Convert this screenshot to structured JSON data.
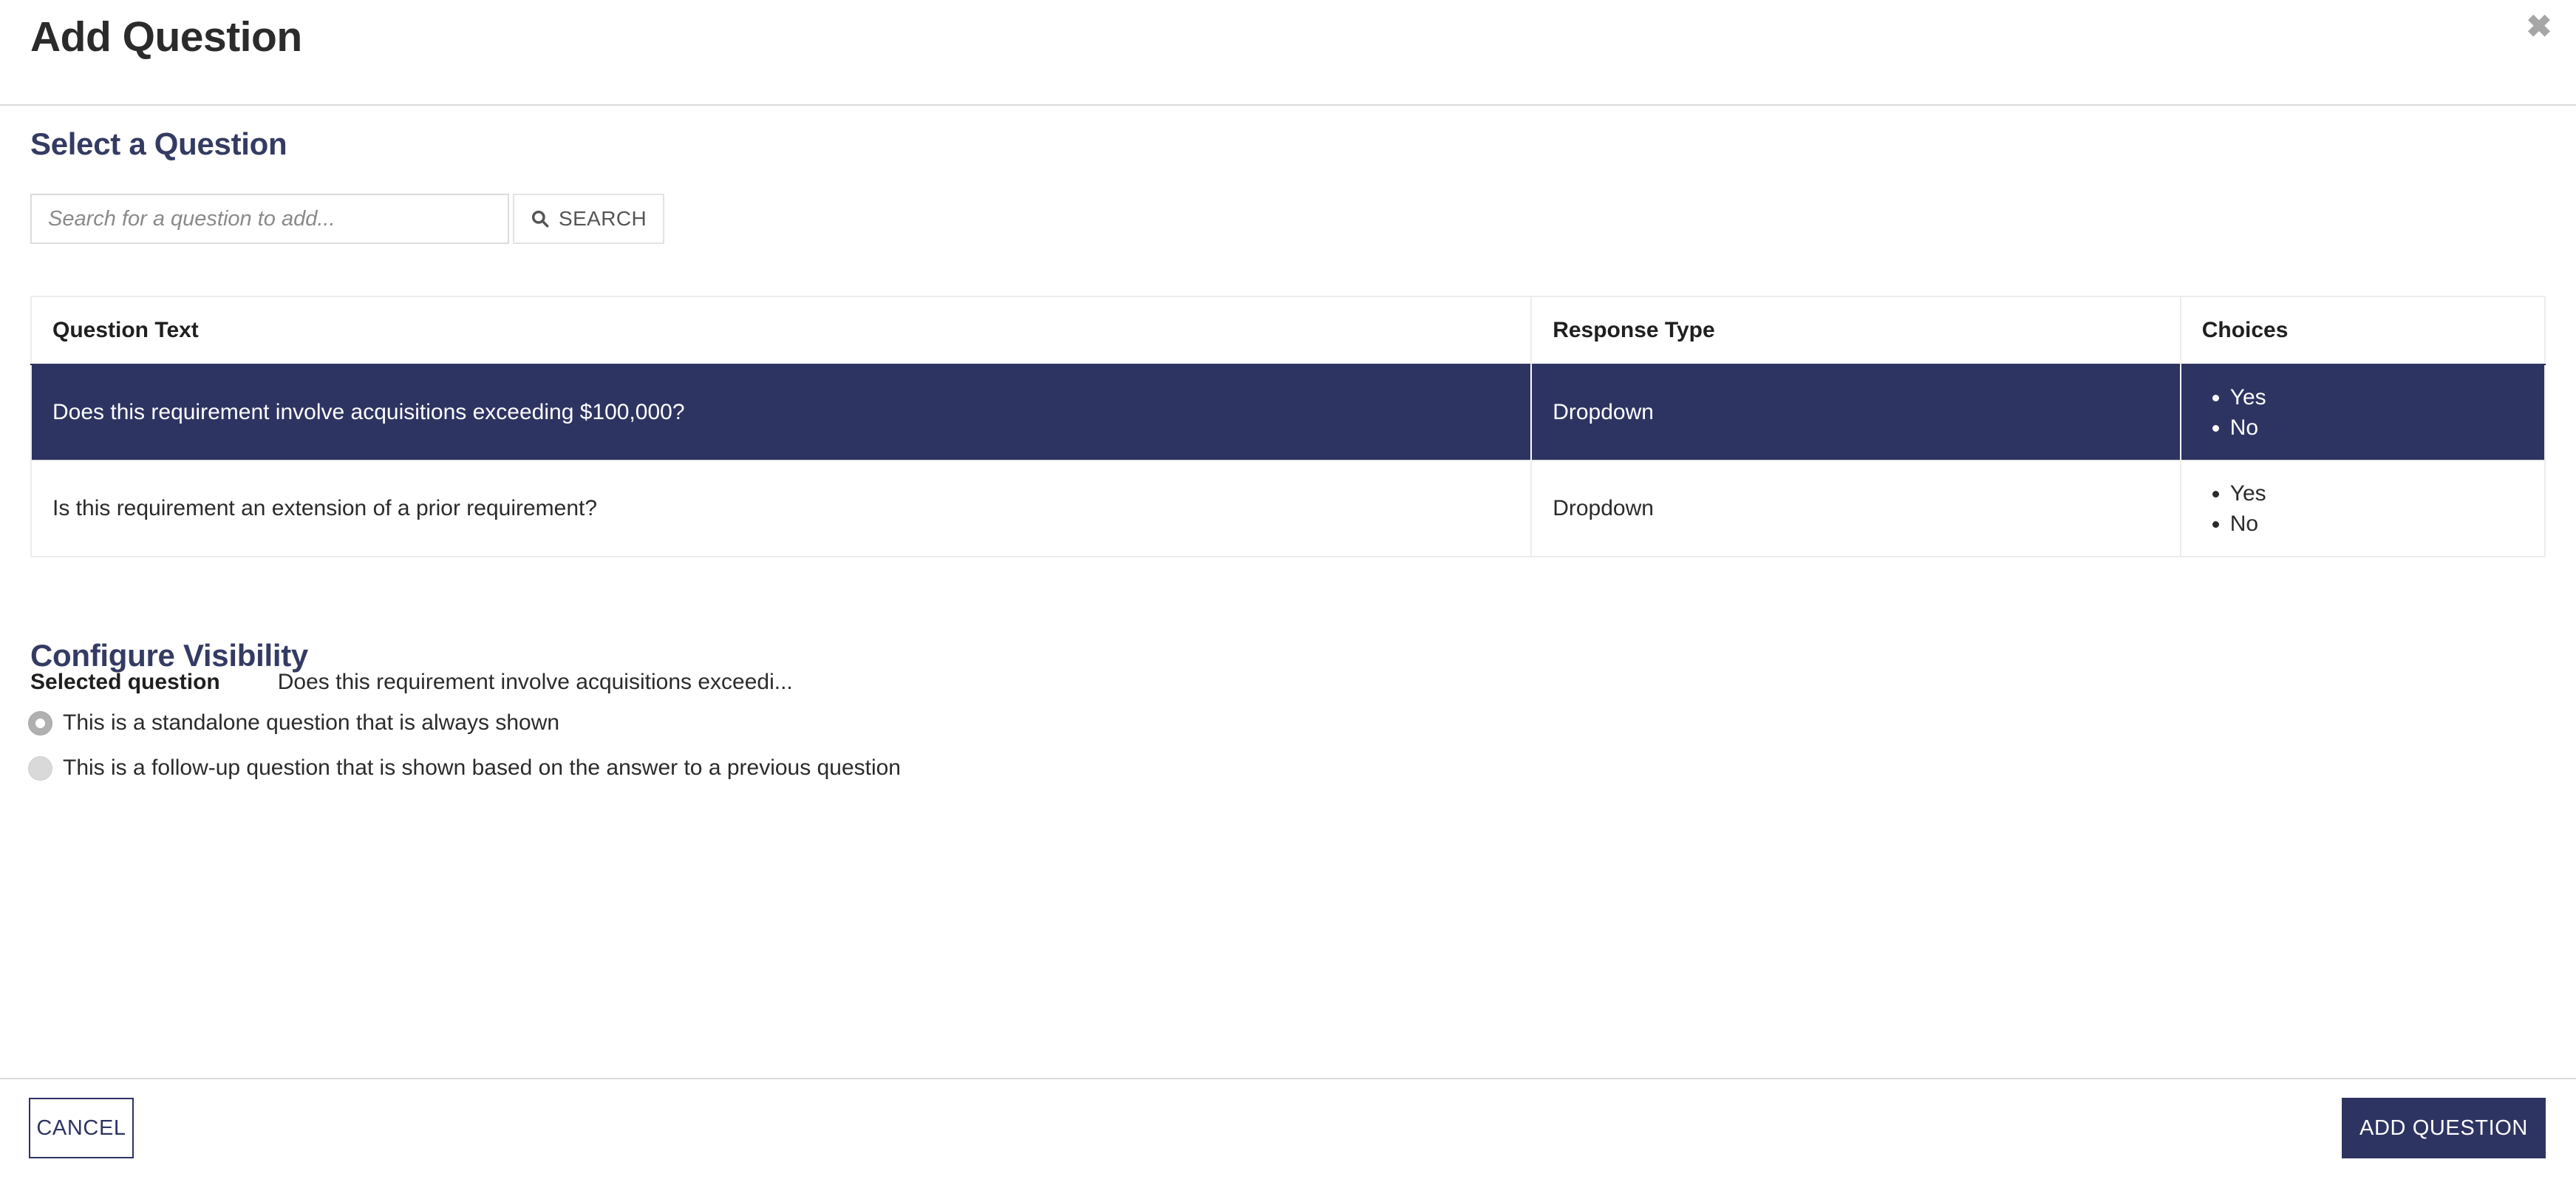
{
  "modal": {
    "title": "Add Question",
    "close_icon": "close-icon"
  },
  "select_question": {
    "heading": "Select a Question",
    "search": {
      "placeholder": "Search for a question to add...",
      "value": "",
      "button_label": "SEARCH",
      "button_icon": "search-icon"
    },
    "table": {
      "columns": [
        "Question Text",
        "Response Type",
        "Choices"
      ],
      "rows": [
        {
          "question_text": "Does this requirement involve acquisitions exceeding $100,000?",
          "response_type": "Dropdown",
          "choices": [
            "Yes",
            "No"
          ],
          "selected": true
        },
        {
          "question_text": "Is this requirement an extension of a prior requirement?",
          "response_type": "Dropdown",
          "choices": [
            "Yes",
            "No"
          ],
          "selected": false
        }
      ]
    },
    "selected_question": {
      "label": "Selected question",
      "value": "Does this requirement involve acquisitions exceedi..."
    }
  },
  "configure_visibility": {
    "heading": "Configure Visibility",
    "options": [
      {
        "label": "This is a standalone question that is always shown",
        "checked": true
      },
      {
        "label": "This is a follow-up question that is shown based on the answer to a previous question",
        "checked": false
      }
    ]
  },
  "footer": {
    "cancel_label": "CANCEL",
    "add_question_label": "ADD QUESTION"
  },
  "colors": {
    "navy": "#2e3462",
    "heading_navy": "#343b63",
    "border_grey": "#dcdcdc",
    "table_border": "#ececec",
    "close_grey": "#a6a6a6"
  }
}
